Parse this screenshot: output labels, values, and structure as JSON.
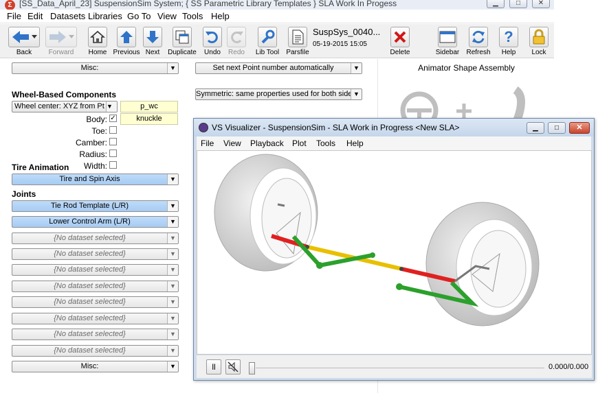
{
  "window": {
    "title": "[SS_Data_April_23] SuspensionSim System; { SS Parametric Library Templates } SLA Work In Progess",
    "app_icon_letter": "Σ"
  },
  "menu": [
    "File",
    "Edit",
    "Datasets",
    "Libraries",
    "Go To",
    "View",
    "Tools",
    "Help"
  ],
  "toolbar": {
    "back": "Back",
    "forward": "Forward",
    "home": "Home",
    "previous": "Previous",
    "next": "Next",
    "duplicate": "Duplicate",
    "undo": "Undo",
    "redo": "Redo",
    "lib_tool": "Lib Tool",
    "parsfile": "Parsfile",
    "dataset_name": "SuspSys_0040...",
    "dataset_date": "05-19-2015 15:05",
    "delete": "Delete",
    "sidebar": "Sidebar",
    "refresh": "Refresh",
    "help": "Help",
    "lock": "Lock"
  },
  "left": {
    "misc_top": "Misc:",
    "wheel_heading": "Wheel-Based Components",
    "wheel_center": "Wheel center: XYZ from Pt",
    "p_wc": "p_wc",
    "body_label": "Body:",
    "knuckle": "knuckle",
    "toe_label": "Toe:",
    "camber_label": "Camber:",
    "radius_label": "Radius:",
    "width_label": "Width:",
    "tire_heading": "Tire Animation",
    "tire_combo": "Tire and Spin Axis",
    "joints_heading": "Joints",
    "joint1": "Tie Rod Template (L/R)",
    "joint2": "Lower Control Arm (L/R)",
    "empty": "{No dataset selected}",
    "misc_bottom": "Misc:"
  },
  "middle": {
    "point_combo": "Set next Point number automatically",
    "symmetric_combo": "Symmetric: same properties used for both sides"
  },
  "right": {
    "assembly_title": "Animator Shape Assembly"
  },
  "visualizer": {
    "title": "VS Visualizer - SuspensionSim - SLA Work in Progress <New SLA>",
    "menu": [
      "File",
      "View",
      "Playback",
      "Plot",
      "Tools",
      "Help"
    ],
    "time_readout": "0.000/0.000"
  },
  "colors": {
    "accent_blue": "#a6cbf3",
    "tie_rod_red": "#e02020",
    "tie_rod_yellow": "#e8c000",
    "arm_green": "#2ca02c",
    "tire_gray": "#cfcfcf"
  }
}
